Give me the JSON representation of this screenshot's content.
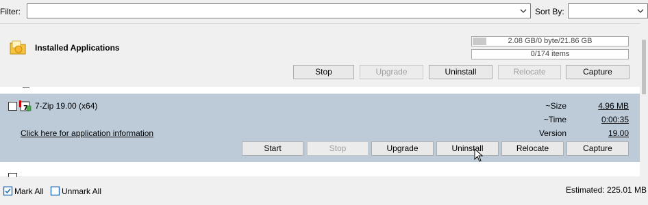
{
  "toolbar": {
    "filter_label": "Filter:",
    "filter_value": "",
    "sortby_label": "Sort By:",
    "sortby_value": ""
  },
  "group": {
    "title": "Installed Applications",
    "size_progress": "2.08 GB/0 byte/21.86 GB",
    "size_fraction": 0.095,
    "items_progress": "0/174 items",
    "items_fraction": 0,
    "buttons": {
      "stop": "Stop",
      "upgrade": "Upgrade",
      "uninstall": "Uninstall",
      "relocate": "Relocate",
      "capture": "Capture"
    }
  },
  "app": {
    "name": "7-Zip 19.00 (x64)",
    "info_link": "Click here for application information",
    "size_label": "~Size",
    "size_value": "4.96 MB",
    "time_label": "~Time",
    "time_value": "0:00:35",
    "version_label": "Version",
    "version_value": "19.00",
    "buttons": {
      "start": "Start",
      "stop": "Stop",
      "upgrade": "Upgrade",
      "uninstall": "Uninstall",
      "relocate": "Relocate",
      "capture": "Capture"
    }
  },
  "footer": {
    "mark_all": "Mark All",
    "unmark_all": "Unmark All",
    "estimated": "Estimated: 225.01 MB"
  },
  "colors": {
    "selected_row": "#bdcbd9",
    "window_bg": "#f0f0f0"
  },
  "icons": [
    "folder-apps-icon",
    "app-7zip-icon",
    "chevron-down-icon",
    "mark-all-icon",
    "unmark-all-icon",
    "mouse-cursor-icon"
  ]
}
